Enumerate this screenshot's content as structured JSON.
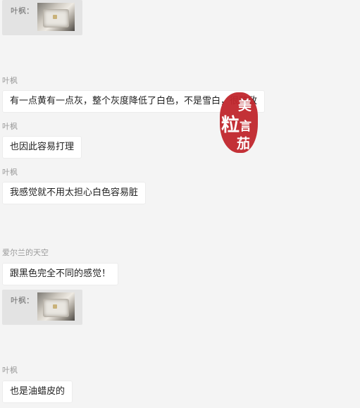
{
  "messages": [
    {
      "type": "quote",
      "label": "叶枫：",
      "image": "bag-photo"
    },
    {
      "type": "text",
      "name": "叶枫",
      "text": "有一点黄有一点灰，整个灰度降低了白色，不是雪白，很雅致"
    },
    {
      "type": "text",
      "name": "叶枫",
      "text": "也因此容易打理"
    },
    {
      "type": "text",
      "name": "叶枫",
      "text": "我感觉就不用太担心白色容易脏"
    },
    {
      "type": "text",
      "name": "爱尔兰的天空",
      "text": "跟黑色完全不同的感觉！"
    },
    {
      "type": "quote",
      "label": "叶枫：",
      "image": "bag-photo"
    },
    {
      "type": "text",
      "name": "叶枫",
      "text": "也是油蜡皮的"
    }
  ],
  "watermark": {
    "type": "seal",
    "text": "美粒言茄",
    "color": "#c1272d"
  }
}
